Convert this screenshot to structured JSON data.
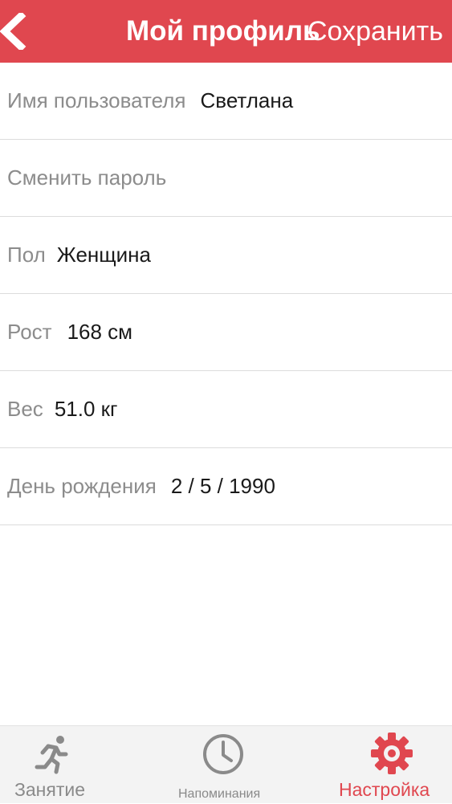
{
  "header": {
    "title": "Мой профиль",
    "save_label": "Сохранить",
    "background": "#e0474f"
  },
  "profile": {
    "username_label": "Имя пользователя",
    "username_value": "Светлана",
    "change_password_label": "Сменить пароль",
    "gender_label": "Пол",
    "gender_value": "Женщина",
    "height_label": "Рост",
    "height_value": "168 см",
    "weight_label": "Вес",
    "weight_value": "51.0 кг",
    "birthday_label": "День рождения",
    "birthday_value": "2 / 5 / 1990"
  },
  "tabs": [
    {
      "label": "Занятие",
      "icon": "running-man-icon",
      "active": false
    },
    {
      "label": "Напоминания",
      "icon": "clock-icon",
      "active": false
    },
    {
      "label": "Настройка",
      "icon": "gear-icon",
      "active": true
    }
  ],
  "colors": {
    "accent": "#e0474f",
    "inactive_tab": "#8a8a8a",
    "label": "#8c8c8c",
    "value": "#1a1a1a"
  }
}
